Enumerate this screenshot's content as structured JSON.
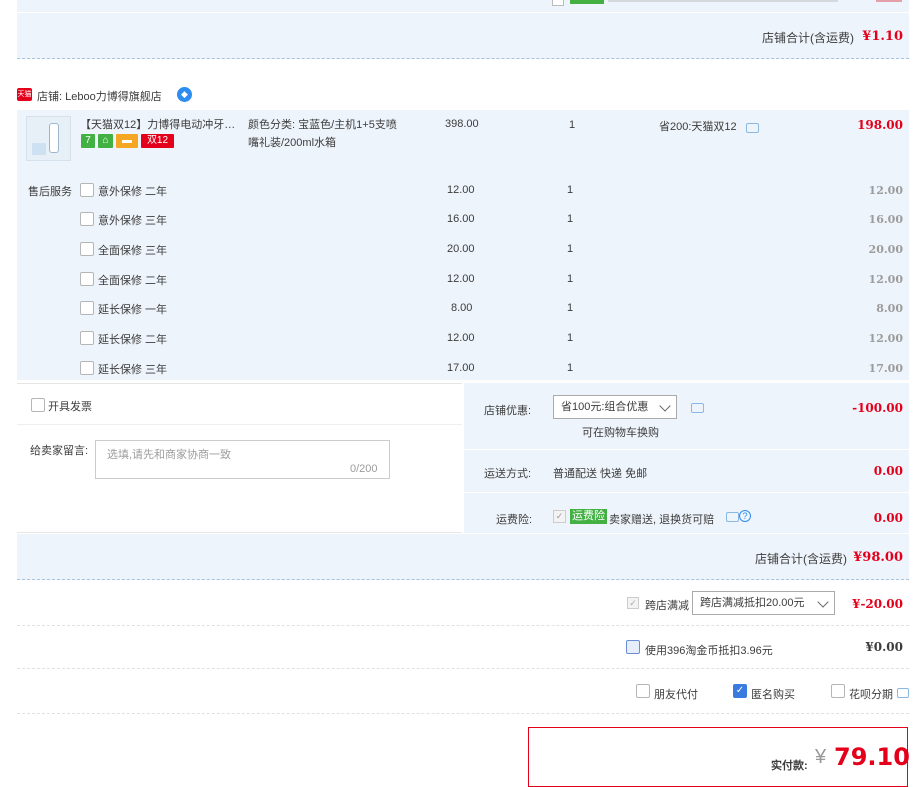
{
  "prev_shop": {
    "total_label": "店铺合计(含运费)",
    "total_value": "¥1.10"
  },
  "shop": {
    "badge_text": "天猫",
    "label": "店铺: Leboo力博得旗舰店"
  },
  "item": {
    "title": "【天猫双12】力博得电动冲牙…",
    "badges": [
      "7",
      "",
      "",
      "双12"
    ],
    "sku_line1": "颜色分类: 宝蓝色/主机1+5支喷",
    "sku_line2": "嘴礼装/200ml水箱",
    "unit_price": "398.00",
    "qty": "1",
    "promo": "省200:天猫双12",
    "subtotal": "198.00"
  },
  "services": {
    "label": "售后服务",
    "items": [
      {
        "name": "意外保修 二年",
        "price": "12.00",
        "qty": "1",
        "total": "12.00"
      },
      {
        "name": "意外保修 三年",
        "price": "16.00",
        "qty": "1",
        "total": "16.00"
      },
      {
        "name": "全面保修 三年",
        "price": "20.00",
        "qty": "1",
        "total": "20.00"
      },
      {
        "name": "全面保修 二年",
        "price": "12.00",
        "qty": "1",
        "total": "12.00"
      },
      {
        "name": "延长保修 一年",
        "price": "8.00",
        "qty": "1",
        "total": "8.00"
      },
      {
        "name": "延长保修 二年",
        "price": "12.00",
        "qty": "1",
        "total": "12.00"
      },
      {
        "name": "延长保修 三年",
        "price": "17.00",
        "qty": "1",
        "total": "17.00"
      }
    ]
  },
  "invoice": {
    "label": "开具发票"
  },
  "message": {
    "label": "给卖家留言:",
    "placeholder": "选填,请先和商家协商一致",
    "count": "0/200"
  },
  "shop_discount": {
    "label": "店铺优惠:",
    "selected": "省100元:组合优惠",
    "note": "可在购物车换购",
    "value": "-100.00"
  },
  "shipping": {
    "label": "运送方式:",
    "method": "普通配送 快递 免邮",
    "value": "0.00"
  },
  "insurance": {
    "label": "运费险:",
    "tag": "运费险",
    "text": "卖家赠送, 退换货可赔",
    "value": "0.00"
  },
  "shop_total": {
    "label": "店铺合计(含运费)",
    "value": "¥98.00"
  },
  "cross_shop": {
    "label": "跨店满减",
    "selected": "跨店满减抵扣20.00元",
    "value": "¥-20.00"
  },
  "taojinbi": {
    "label": "使用396淘金币抵扣3.96元",
    "value": "¥0.00"
  },
  "options": {
    "friend_pay": "朋友代付",
    "anonymous": "匿名购买",
    "huabei": "花呗分期"
  },
  "pay": {
    "label": "实付款:",
    "currency": "¥",
    "amount": "79.10"
  },
  "colors": {
    "accent_red": "#e4001b",
    "panel_blue": "#eef4fb",
    "link_blue": "#2d8cf0",
    "tag_green": "#42b043"
  }
}
